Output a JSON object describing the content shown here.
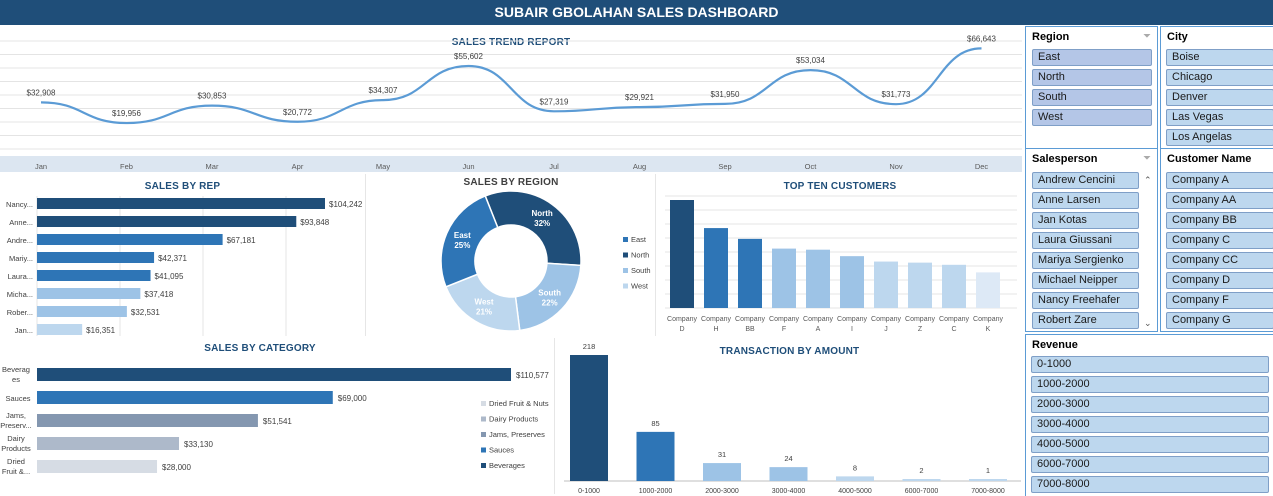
{
  "title": "SUBAIR GBOLAHAN SALES DASHBOARD",
  "trend": {
    "title": "SALES TREND REPORT",
    "months": [
      "Jan",
      "Feb",
      "Mar",
      "Apr",
      "May",
      "Jun",
      "Jul",
      "Aug",
      "Sep",
      "Oct",
      "Nov",
      "Dec"
    ],
    "values": [
      32908,
      19956,
      30853,
      20772,
      34307,
      55602,
      27319,
      29921,
      31950,
      53034,
      31773,
      66643
    ],
    "labels": [
      "$32,908",
      "$19,956",
      "$30,853",
      "$20,772",
      "$34,307",
      "$55,602",
      "$27,319",
      "$29,921",
      "$31,950",
      "$53,034",
      "$31,773",
      "$66,643"
    ],
    "ylim": [
      0,
      70000
    ]
  },
  "rep": {
    "title": "SALES BY REP",
    "names": [
      "Nancy...",
      "Anne...",
      "Andre...",
      "Mariy...",
      "Laura...",
      "Micha...",
      "Rober...",
      "Jan..."
    ],
    "values": [
      104242,
      93848,
      67181,
      42371,
      41095,
      37418,
      32531,
      16351
    ],
    "labels": [
      "$104,242",
      "$93,848",
      "$67,181",
      "$42,371",
      "$41,095",
      "$37,418",
      "$32,531",
      "$16,351"
    ],
    "colors": [
      "#1f4e79",
      "#1f4e79",
      "#2e75b6",
      "#2e75b6",
      "#2e75b6",
      "#9dc3e6",
      "#9dc3e6",
      "#bdd7ee"
    ]
  },
  "region": {
    "title": "SALES BY REGION",
    "slices": [
      {
        "name": "North",
        "pct": "32%",
        "value": 32,
        "color": "#1f4e79"
      },
      {
        "name": "South",
        "pct": "22%",
        "value": 22,
        "color": "#9dc3e6"
      },
      {
        "name": "West",
        "pct": "21%",
        "value": 21,
        "color": "#bdd7ee"
      },
      {
        "name": "East",
        "pct": "25%",
        "value": 25,
        "color": "#2e75b6"
      }
    ],
    "legend": [
      {
        "name": "East",
        "color": "#2e75b6"
      },
      {
        "name": "North",
        "color": "#1f4e79"
      },
      {
        "name": "South",
        "color": "#9dc3e6"
      },
      {
        "name": "West",
        "color": "#bdd7ee"
      }
    ]
  },
  "customers": {
    "title": "TOP TEN CUSTOMERS",
    "line1": [
      "Company",
      "Company",
      "Company",
      "Company",
      "Company",
      "Company",
      "Company",
      "Company",
      "Company",
      "Company"
    ],
    "line2": [
      "D",
      "H",
      "BB",
      "F",
      "A",
      "I",
      "J",
      "Z",
      "C",
      "K"
    ],
    "values": [
      100,
      74,
      64,
      55,
      54,
      48,
      43,
      42,
      40,
      33
    ],
    "colors": [
      "#1f4e79",
      "#2e75b6",
      "#2e75b6",
      "#9dc3e6",
      "#9dc3e6",
      "#9dc3e6",
      "#bdd7ee",
      "#bdd7ee",
      "#bdd7ee",
      "#dde9f6"
    ]
  },
  "category": {
    "title": "SALES BY CATEGORY",
    "names": [
      [
        "Beverag",
        "es"
      ],
      [
        "Sauces"
      ],
      [
        "Jams,",
        "Preserv..."
      ],
      [
        "Dairy",
        "Products"
      ],
      [
        "Dried",
        "Fruit &..."
      ]
    ],
    "values": [
      110577,
      69000,
      51541,
      33130,
      28000
    ],
    "labels": [
      "$110,577",
      "$69,000",
      "$51,541",
      "$33,130",
      "$28,000"
    ],
    "colors": [
      "#1f4e79",
      "#2e75b6",
      "#8497b0",
      "#adb9ca",
      "#d6dce4"
    ],
    "legend": [
      {
        "name": "Dried Fruit & Nuts",
        "color": "#d6dce4"
      },
      {
        "name": "Dairy Products",
        "color": "#adb9ca"
      },
      {
        "name": "Jams, Preserves",
        "color": "#8497b0"
      },
      {
        "name": "Sauces",
        "color": "#2e75b6"
      },
      {
        "name": "Beverages",
        "color": "#1f4e79"
      }
    ]
  },
  "transactions": {
    "title": "TRANSACTION BY AMOUNT",
    "categories": [
      "0-1000",
      "1000-2000",
      "2000-3000",
      "3000-4000",
      "4000-5000",
      "6000-7000",
      "7000-8000"
    ],
    "values": [
      218,
      85,
      31,
      24,
      8,
      2,
      1
    ],
    "colors": [
      "#1f4e79",
      "#2e75b6",
      "#9dc3e6",
      "#9dc3e6",
      "#bdd7ee",
      "#bdd7ee",
      "#bdd7ee"
    ]
  },
  "slicers": {
    "region": {
      "title": "Region",
      "items": [
        "East",
        "North",
        "South",
        "West"
      ]
    },
    "city": {
      "title": "City",
      "items": [
        "Boise",
        "Chicago",
        "Denver",
        "Las Vegas",
        "Los Angelas"
      ]
    },
    "salesperson": {
      "title": "Salesperson",
      "items": [
        "Andrew Cencini",
        "Anne Larsen",
        "Jan Kotas",
        "Laura Giussani",
        "Mariya Sergienko",
        "Michael Neipper",
        "Nancy Freehafer",
        "Robert Zare"
      ]
    },
    "customer": {
      "title": "Customer Name",
      "items": [
        "Company A",
        "Company AA",
        "Company BB",
        "Company C",
        "Company CC",
        "Company D",
        "Company F",
        "Company G"
      ]
    },
    "revenue": {
      "title": "Revenue",
      "items": [
        "0-1000",
        "1000-2000",
        "2000-3000",
        "3000-4000",
        "4000-5000",
        "6000-7000",
        "7000-8000"
      ]
    }
  },
  "icons": {
    "filter": "filter-clear-icon",
    "scroll_up": "chevron-up-icon",
    "scroll_down": "chevron-down-icon"
  }
}
